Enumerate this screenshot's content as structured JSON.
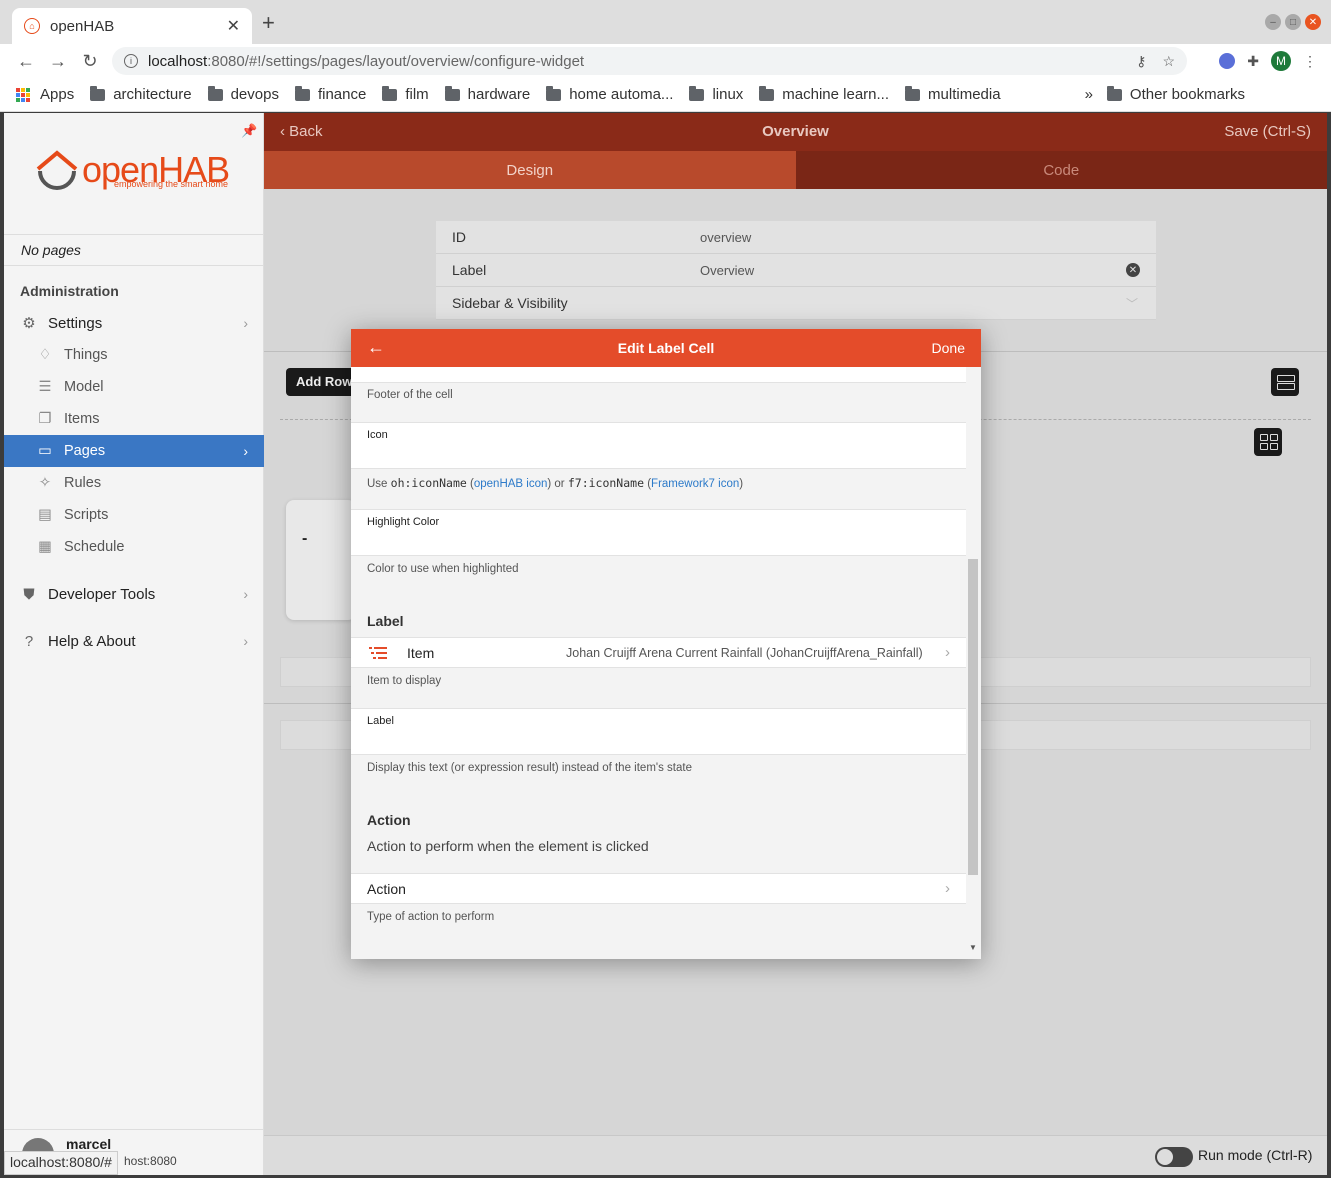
{
  "browser": {
    "tab_title": "openHAB",
    "new_tab": "+",
    "url_host": "localhost",
    "url_path": ":8080/#!/settings/pages/layout/overview/configure-widget",
    "profile_initial": "M",
    "bookmarks": [
      "Apps",
      "architecture",
      "devops",
      "finance",
      "film",
      "hardware",
      "home automa...",
      "linux",
      "machine learn...",
      "multimedia"
    ],
    "bookmarks_more": "»",
    "other_bookmarks": "Other bookmarks",
    "status_url": "localhost:8080/#"
  },
  "sidebar": {
    "logo_text": "openHAB",
    "logo_tagline": "empowering the smart home",
    "no_pages": "No pages",
    "section": "Administration",
    "items": [
      {
        "label": "Settings",
        "icon": "gear-icon"
      },
      {
        "label": "Things",
        "icon": "lightbulb-icon"
      },
      {
        "label": "Model",
        "icon": "list-tree-icon"
      },
      {
        "label": "Items",
        "icon": "items-icon"
      },
      {
        "label": "Pages",
        "icon": "monitor-icon"
      },
      {
        "label": "Rules",
        "icon": "wand-icon"
      },
      {
        "label": "Scripts",
        "icon": "document-icon"
      },
      {
        "label": "Schedule",
        "icon": "calendar-icon"
      },
      {
        "label": "Developer Tools",
        "icon": "shield-icon"
      },
      {
        "label": "Help & About",
        "icon": "help-icon"
      }
    ],
    "user_name": "marcel",
    "user_host": "host:8080"
  },
  "page": {
    "back_label": "Back",
    "title": "Overview",
    "save_label": "Save (Ctrl-S)",
    "tabs": [
      "Design",
      "Code"
    ],
    "form": {
      "id_label": "ID",
      "id_value": "overview",
      "label_label": "Label",
      "label_value": "Overview",
      "sidebar_label": "Sidebar & Visibility"
    },
    "add_row": "Add Row",
    "card_text": "-",
    "run_mode": "Run mode (Ctrl-R)"
  },
  "modal": {
    "title": "Edit Label Cell",
    "done": "Done",
    "footer_hint": "Footer of the cell",
    "icon_label": "Icon",
    "icon_hint": {
      "pre": "Use ",
      "code1": "oh:iconName",
      "open1": " (",
      "link1": "openHAB icon",
      "mid": ") or ",
      "code2": "f7:iconName",
      "open2": " (",
      "link2": "Framework7 icon",
      "post": ")"
    },
    "highlight_label": "Highlight Color",
    "highlight_hint": "Color to use when highlighted",
    "label_section": "Label",
    "item_label": "Item",
    "item_value": "Johan Cruijff Arena Current Rainfall (JohanCruijffArena_Rainfall)",
    "item_hint": "Item to display",
    "label_field": "Label",
    "label_hint": "Display this text (or expression result) instead of the item's state",
    "action_section": "Action",
    "action_desc": "Action to perform when the element is clicked",
    "action_label": "Action",
    "action_hint": "Type of action to perform"
  }
}
